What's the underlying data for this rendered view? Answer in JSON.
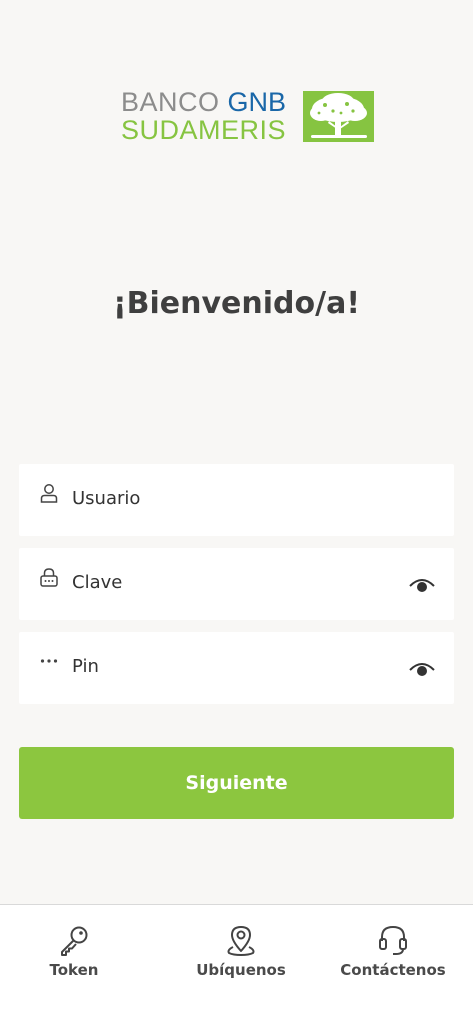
{
  "logo": {
    "word_banco": "BANCO",
    "word_gnb": "GNB",
    "word_sudameris": "SUDAMERIS",
    "colors": {
      "grey": "#8c8c8c",
      "blue": "#1a67a8",
      "green": "#86c441"
    },
    "icon": "oak-tree-icon"
  },
  "welcome": {
    "title": "¡Bienvenido/a!"
  },
  "form": {
    "usuario": {
      "label": "Usuario",
      "icon": "user-icon"
    },
    "clave": {
      "label": "Clave",
      "icon": "lock-icon",
      "toggle_icon": "eye-icon"
    },
    "pin": {
      "label": "Pin",
      "icon": "dots-icon",
      "toggle_icon": "eye-icon"
    },
    "submit_label": "Siguiente",
    "accent": "#8cc63f"
  },
  "nav": {
    "items": [
      {
        "label": "Token",
        "icon": "key-icon"
      },
      {
        "label": "Ubíquenos",
        "icon": "map-pin-icon"
      },
      {
        "label": "Contáctenos",
        "icon": "headset-icon"
      }
    ]
  }
}
